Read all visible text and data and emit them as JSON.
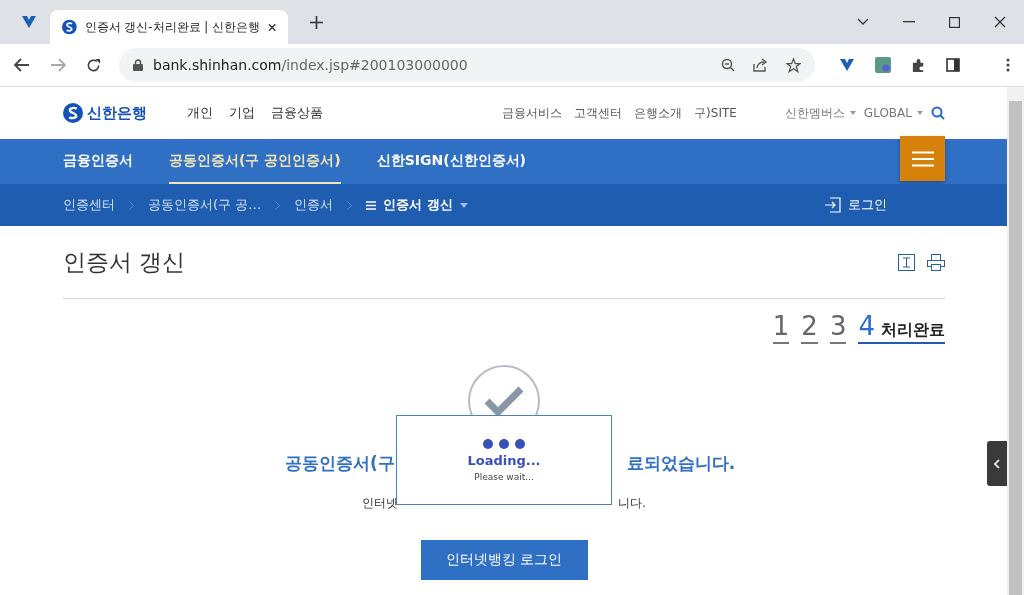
{
  "browser": {
    "tabs": [
      {
        "title": "인증서 갱신-처리완료 | 신한은행",
        "selected": true
      }
    ],
    "url_host": "bank.shinhan.com",
    "url_path": "/index.jsp#200103000000"
  },
  "header": {
    "logo": "신한은행",
    "main_menu": [
      "개인",
      "기업",
      "금융상품"
    ],
    "util_menu": [
      "금융서비스",
      "고객센터",
      "은행소개",
      "구)SITE"
    ],
    "dropdowns": [
      "신한멤버스",
      "GLOBAL"
    ]
  },
  "nav_tabs": [
    {
      "label": "금융인증서",
      "selected": false
    },
    {
      "label": "공동인증서(구 공인인증서)",
      "selected": true
    },
    {
      "label": "신한SIGN(신한인증서)",
      "selected": false
    }
  ],
  "breadcrumb": [
    "인증센터",
    "공동인증서(구 공…",
    "인증서"
  ],
  "breadcrumb_current": "인증서 갱신",
  "login_link": "로그인",
  "page_title": "인증서 갱신",
  "steps": [
    {
      "number": "1",
      "selected": false
    },
    {
      "number": "2",
      "selected": false
    },
    {
      "number": "3",
      "selected": false
    },
    {
      "number": "4",
      "label": "처리완료",
      "selected": true
    }
  ],
  "result": {
    "heading_left": "공동인증서(구",
    "heading_right": "료되었습니다.",
    "message_left": "인터넷",
    "message_right": "니다.",
    "button": "인터넷뱅킹 로그인"
  },
  "loading": {
    "title": "Loading...",
    "subtitle": "Please wait..."
  }
}
